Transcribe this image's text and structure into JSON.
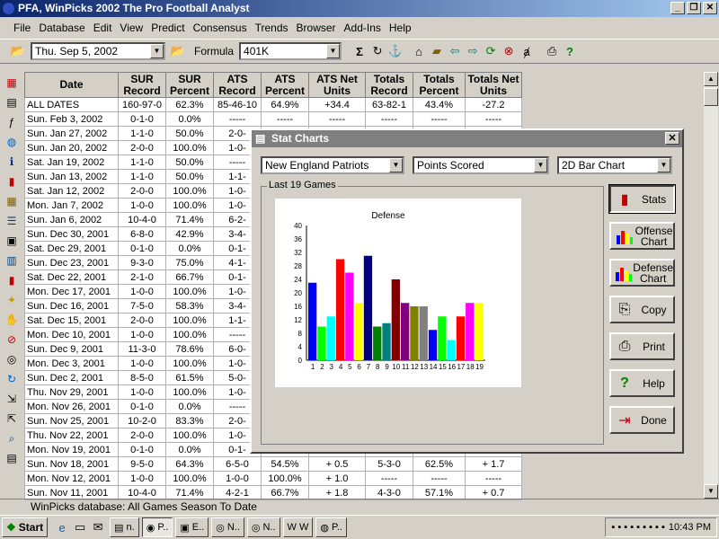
{
  "window": {
    "title": "PFA, WinPicks 2002 The Pro Football Analyst"
  },
  "menu": [
    "File",
    "Database",
    "Edit",
    "View",
    "Predict",
    "Consensus",
    "Trends",
    "Browser",
    "Add-Ins",
    "Help"
  ],
  "toolbar": {
    "date_value": "Thu. Sep  5, 2002",
    "formula_label": "Formula",
    "formula_value": "401K"
  },
  "table": {
    "headers": [
      [
        "Date",
        ""
      ],
      [
        "SUR",
        "Record"
      ],
      [
        "SUR",
        "Percent"
      ],
      [
        "ATS",
        "Record"
      ],
      [
        "ATS",
        "Percent"
      ],
      [
        "ATS Net",
        "Units"
      ],
      [
        "Totals",
        "Record"
      ],
      [
        "Totals",
        "Percent"
      ],
      [
        "Totals Net",
        "Units"
      ]
    ],
    "rows": [
      [
        "ALL DATES",
        "160-97-0",
        "62.3%",
        "85-46-10",
        "64.9%",
        "+34.4",
        "63-82-1",
        "43.4%",
        "-27.2"
      ],
      [
        "Sun. Feb  3, 2002",
        "0-1-0",
        "0.0%",
        "-----",
        "-----",
        "-----",
        "-----",
        "-----",
        "-----"
      ],
      [
        "Sun. Jan 27, 2002",
        "1-1-0",
        "50.0%",
        "2-0-",
        "",
        "",
        "",
        "",
        ""
      ],
      [
        "Sun. Jan 20, 2002",
        "2-0-0",
        "100.0%",
        "1-0-",
        "",
        "",
        "",
        "",
        ""
      ],
      [
        "Sat. Jan 19, 2002",
        "1-1-0",
        "50.0%",
        "-----",
        "",
        "",
        "",
        "",
        ""
      ],
      [
        "Sun. Jan 13, 2002",
        "1-1-0",
        "50.0%",
        "1-1-",
        "",
        "",
        "",
        "",
        ""
      ],
      [
        "Sat. Jan 12, 2002",
        "2-0-0",
        "100.0%",
        "1-0-",
        "",
        "",
        "",
        "",
        ""
      ],
      [
        "Mon. Jan  7, 2002",
        "1-0-0",
        "100.0%",
        "1-0-",
        "",
        "",
        "",
        "",
        ""
      ],
      [
        "Sun. Jan  6, 2002",
        "10-4-0",
        "71.4%",
        "6-2-",
        "",
        "",
        "",
        "",
        ""
      ],
      [
        "Sun. Dec 30, 2001",
        "6-8-0",
        "42.9%",
        "3-4-",
        "",
        "",
        "",
        "",
        ""
      ],
      [
        "Sat. Dec 29, 2001",
        "0-1-0",
        "0.0%",
        "0-1-",
        "",
        "",
        "",
        "",
        ""
      ],
      [
        "Sun. Dec 23, 2001",
        "9-3-0",
        "75.0%",
        "4-1-",
        "",
        "",
        "",
        "",
        ""
      ],
      [
        "Sat. Dec 22, 2001",
        "2-1-0",
        "66.7%",
        "0-1-",
        "",
        "",
        "",
        "",
        ""
      ],
      [
        "Mon. Dec 17, 2001",
        "1-0-0",
        "100.0%",
        "1-0-",
        "",
        "",
        "",
        "",
        ""
      ],
      [
        "Sun. Dec 16, 2001",
        "7-5-0",
        "58.3%",
        "3-4-",
        "",
        "",
        "",
        "",
        ""
      ],
      [
        "Sat. Dec 15, 2001",
        "2-0-0",
        "100.0%",
        "1-1-",
        "",
        "",
        "",
        "",
        ""
      ],
      [
        "Mon. Dec 10, 2001",
        "1-0-0",
        "100.0%",
        "-----",
        "",
        "",
        "",
        "",
        ""
      ],
      [
        "Sun. Dec  9, 2001",
        "11-3-0",
        "78.6%",
        "6-0-",
        "",
        "",
        "",
        "",
        ""
      ],
      [
        "Mon. Dec  3, 2001",
        "1-0-0",
        "100.0%",
        "1-0-",
        "",
        "",
        "",
        "",
        ""
      ],
      [
        "Sun. Dec  2, 2001",
        "8-5-0",
        "61.5%",
        "5-0-",
        "",
        "",
        "",
        "",
        ""
      ],
      [
        "Thu. Nov 29, 2001",
        "1-0-0",
        "100.0%",
        "1-0-",
        "",
        "",
        "",
        "",
        ""
      ],
      [
        "Mon. Nov 26, 2001",
        "0-1-0",
        "0.0%",
        "-----",
        "",
        "",
        "",
        "",
        ""
      ],
      [
        "Sun. Nov 25, 2001",
        "10-2-0",
        "83.3%",
        "2-0-",
        "",
        "",
        "",
        "",
        ""
      ],
      [
        "Thu. Nov 22, 2001",
        "2-0-0",
        "100.0%",
        "1-0-",
        "",
        "",
        "",
        "",
        ""
      ],
      [
        "Mon. Nov 19, 2001",
        "0-1-0",
        "0.0%",
        "0-1-",
        "",
        "",
        "",
        "",
        ""
      ],
      [
        "Sun. Nov 18, 2001",
        "9-5-0",
        "64.3%",
        "6-5-0",
        "54.5%",
        "+ 0.5",
        "5-3-0",
        "62.5%",
        "+ 1.7"
      ],
      [
        "Mon. Nov 12, 2001",
        "1-0-0",
        "100.0%",
        "1-0-0",
        "100.0%",
        "+ 1.0",
        "-----",
        "-----",
        "-----"
      ],
      [
        "Sun. Nov 11, 2001",
        "10-4-0",
        "71.4%",
        "4-2-1",
        "66.7%",
        "+ 1.8",
        "4-3-0",
        "57.1%",
        "+ 0.7"
      ]
    ]
  },
  "status": "WinPicks database:  All Games Season To Date",
  "taskbar": {
    "start": "Start",
    "tasks": [
      "n.",
      "P..",
      "E..",
      "N..",
      "N..",
      "W",
      "P.."
    ],
    "clock": "10:43 PM"
  },
  "dialog": {
    "title": "Stat Charts",
    "team": "New England Patriots",
    "stat": "Points Scored",
    "chart_type": "2D Bar Chart",
    "group_label": "Last 19 Games",
    "buttons": [
      "Stats",
      "Offense Chart",
      "Defense Chart",
      "Copy",
      "Print",
      "Help",
      "Done"
    ]
  },
  "chart_data": {
    "type": "bar",
    "title": "Defense",
    "categories": [
      "1",
      "2",
      "3",
      "4",
      "5",
      "6",
      "7",
      "8",
      "9",
      "10",
      "11",
      "12",
      "13",
      "14",
      "15",
      "16",
      "17",
      "18",
      "19"
    ],
    "values": [
      23,
      10,
      13,
      30,
      26,
      17,
      31,
      10,
      11,
      24,
      17,
      16,
      16,
      9,
      13,
      6,
      13,
      17,
      17
    ],
    "colors": [
      "#0000ff",
      "#00ff00",
      "#00ffff",
      "#ff0000",
      "#ff00ff",
      "#ffff00",
      "#000080",
      "#008000",
      "#008080",
      "#800000",
      "#800080",
      "#808000",
      "#808080",
      "#0000ff",
      "#00ff00",
      "#00ffff",
      "#ff0000",
      "#ff00ff",
      "#ffff00"
    ],
    "yticks": [
      0,
      4,
      8,
      12,
      16,
      20,
      24,
      28,
      32,
      36,
      40
    ],
    "ylim": [
      0,
      40
    ]
  },
  "icons": {
    "left": [
      "stats-icon",
      "notes-icon",
      "formula-icon",
      "globe-icon",
      "info-icon",
      "book-icon",
      "grid-icon",
      "list-icon",
      "window-icon",
      "table-icon",
      "bar-chart-icon",
      "bulb-icon",
      "hand-icon",
      "no-icon",
      "target-icon",
      "cycle-icon",
      "import-icon",
      "export-icon",
      "magnify-icon",
      "doc-icon"
    ]
  }
}
